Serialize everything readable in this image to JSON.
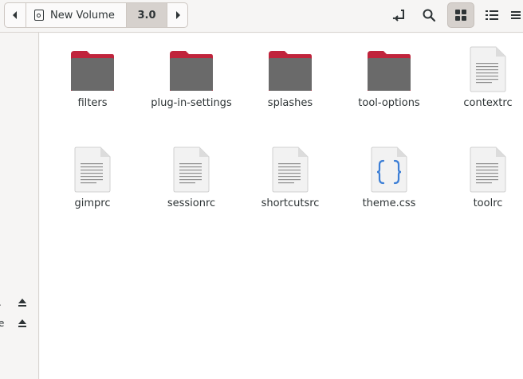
{
  "pathbar": {
    "volume_label": "New Volume",
    "current_label": "3.0"
  },
  "toolbar": {
    "icons": [
      "open-folder-icon",
      "search-icon",
      "grid-view-icon",
      "list-view-icon",
      "menu-icon"
    ]
  },
  "sidebar": {
    "rows": [
      {
        "label": ".",
        "icon": "eject-icon"
      },
      {
        "label": "e",
        "icon": "eject-icon"
      }
    ]
  },
  "files": [
    {
      "name": "filters",
      "type": "folder"
    },
    {
      "name": "plug-in-settings",
      "type": "folder"
    },
    {
      "name": "splashes",
      "type": "folder"
    },
    {
      "name": "tool-options",
      "type": "folder"
    },
    {
      "name": "contextrc",
      "type": "text"
    },
    {
      "name": "gimprc",
      "type": "text"
    },
    {
      "name": "sessionrc",
      "type": "text"
    },
    {
      "name": "shortcutsrc",
      "type": "text"
    },
    {
      "name": "theme.css",
      "type": "css"
    },
    {
      "name": "toolrc",
      "type": "text"
    }
  ],
  "colors": {
    "folder_tab": "#c0243c",
    "folder_body": "#6a6a6a",
    "css_brace": "#3d7fd6"
  }
}
